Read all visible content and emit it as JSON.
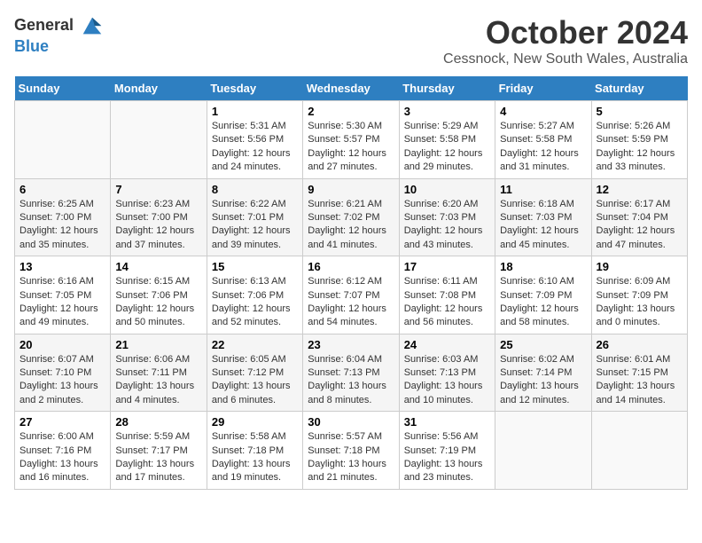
{
  "logo": {
    "line1": "General",
    "line2": "Blue"
  },
  "title": "October 2024",
  "subtitle": "Cessnock, New South Wales, Australia",
  "headers": [
    "Sunday",
    "Monday",
    "Tuesday",
    "Wednesday",
    "Thursday",
    "Friday",
    "Saturday"
  ],
  "weeks": [
    [
      {
        "day": "",
        "info": ""
      },
      {
        "day": "",
        "info": ""
      },
      {
        "day": "1",
        "sunrise": "5:31 AM",
        "sunset": "5:56 PM",
        "daylight": "12 hours and 24 minutes."
      },
      {
        "day": "2",
        "sunrise": "5:30 AM",
        "sunset": "5:57 PM",
        "daylight": "12 hours and 27 minutes."
      },
      {
        "day": "3",
        "sunrise": "5:29 AM",
        "sunset": "5:58 PM",
        "daylight": "12 hours and 29 minutes."
      },
      {
        "day": "4",
        "sunrise": "5:27 AM",
        "sunset": "5:58 PM",
        "daylight": "12 hours and 31 minutes."
      },
      {
        "day": "5",
        "sunrise": "5:26 AM",
        "sunset": "5:59 PM",
        "daylight": "12 hours and 33 minutes."
      }
    ],
    [
      {
        "day": "6",
        "sunrise": "6:25 AM",
        "sunset": "7:00 PM",
        "daylight": "12 hours and 35 minutes."
      },
      {
        "day": "7",
        "sunrise": "6:23 AM",
        "sunset": "7:00 PM",
        "daylight": "12 hours and 37 minutes."
      },
      {
        "day": "8",
        "sunrise": "6:22 AM",
        "sunset": "7:01 PM",
        "daylight": "12 hours and 39 minutes."
      },
      {
        "day": "9",
        "sunrise": "6:21 AM",
        "sunset": "7:02 PM",
        "daylight": "12 hours and 41 minutes."
      },
      {
        "day": "10",
        "sunrise": "6:20 AM",
        "sunset": "7:03 PM",
        "daylight": "12 hours and 43 minutes."
      },
      {
        "day": "11",
        "sunrise": "6:18 AM",
        "sunset": "7:03 PM",
        "daylight": "12 hours and 45 minutes."
      },
      {
        "day": "12",
        "sunrise": "6:17 AM",
        "sunset": "7:04 PM",
        "daylight": "12 hours and 47 minutes."
      }
    ],
    [
      {
        "day": "13",
        "sunrise": "6:16 AM",
        "sunset": "7:05 PM",
        "daylight": "12 hours and 49 minutes."
      },
      {
        "day": "14",
        "sunrise": "6:15 AM",
        "sunset": "7:06 PM",
        "daylight": "12 hours and 50 minutes."
      },
      {
        "day": "15",
        "sunrise": "6:13 AM",
        "sunset": "7:06 PM",
        "daylight": "12 hours and 52 minutes."
      },
      {
        "day": "16",
        "sunrise": "6:12 AM",
        "sunset": "7:07 PM",
        "daylight": "12 hours and 54 minutes."
      },
      {
        "day": "17",
        "sunrise": "6:11 AM",
        "sunset": "7:08 PM",
        "daylight": "12 hours and 56 minutes."
      },
      {
        "day": "18",
        "sunrise": "6:10 AM",
        "sunset": "7:09 PM",
        "daylight": "12 hours and 58 minutes."
      },
      {
        "day": "19",
        "sunrise": "6:09 AM",
        "sunset": "7:09 PM",
        "daylight": "13 hours and 0 minutes."
      }
    ],
    [
      {
        "day": "20",
        "sunrise": "6:07 AM",
        "sunset": "7:10 PM",
        "daylight": "13 hours and 2 minutes."
      },
      {
        "day": "21",
        "sunrise": "6:06 AM",
        "sunset": "7:11 PM",
        "daylight": "13 hours and 4 minutes."
      },
      {
        "day": "22",
        "sunrise": "6:05 AM",
        "sunset": "7:12 PM",
        "daylight": "13 hours and 6 minutes."
      },
      {
        "day": "23",
        "sunrise": "6:04 AM",
        "sunset": "7:13 PM",
        "daylight": "13 hours and 8 minutes."
      },
      {
        "day": "24",
        "sunrise": "6:03 AM",
        "sunset": "7:13 PM",
        "daylight": "13 hours and 10 minutes."
      },
      {
        "day": "25",
        "sunrise": "6:02 AM",
        "sunset": "7:14 PM",
        "daylight": "13 hours and 12 minutes."
      },
      {
        "day": "26",
        "sunrise": "6:01 AM",
        "sunset": "7:15 PM",
        "daylight": "13 hours and 14 minutes."
      }
    ],
    [
      {
        "day": "27",
        "sunrise": "6:00 AM",
        "sunset": "7:16 PM",
        "daylight": "13 hours and 16 minutes."
      },
      {
        "day": "28",
        "sunrise": "5:59 AM",
        "sunset": "7:17 PM",
        "daylight": "13 hours and 17 minutes."
      },
      {
        "day": "29",
        "sunrise": "5:58 AM",
        "sunset": "7:18 PM",
        "daylight": "13 hours and 19 minutes."
      },
      {
        "day": "30",
        "sunrise": "5:57 AM",
        "sunset": "7:18 PM",
        "daylight": "13 hours and 21 minutes."
      },
      {
        "day": "31",
        "sunrise": "5:56 AM",
        "sunset": "7:19 PM",
        "daylight": "13 hours and 23 minutes."
      },
      {
        "day": "",
        "info": ""
      },
      {
        "day": "",
        "info": ""
      }
    ]
  ]
}
